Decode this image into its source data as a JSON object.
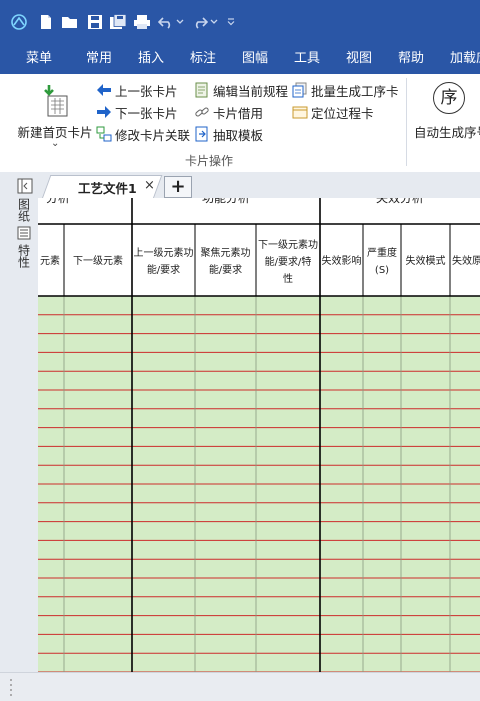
{
  "quick_access": {
    "icons": [
      "app-logo-icon",
      "new-file-icon",
      "open-folder-icon",
      "save-icon",
      "save-all-icon",
      "print-icon",
      "undo-icon",
      "undo-dropdown-icon",
      "redo-icon",
      "redo-dropdown-icon",
      "customize-qat-icon"
    ]
  },
  "menu": {
    "tabs": [
      {
        "label": "菜单"
      },
      {
        "label": "常用"
      },
      {
        "label": "插入"
      },
      {
        "label": "标注"
      },
      {
        "label": "图幅"
      },
      {
        "label": "工具"
      },
      {
        "label": "视图"
      },
      {
        "label": "帮助"
      },
      {
        "label": "加载应"
      }
    ]
  },
  "ribbon": {
    "new_home_card": "新建首页卡片",
    "prev_card": "上一张卡片",
    "next_card": "下一张卡片",
    "modify_card_link": "修改卡片关联",
    "edit_current_rule": "编辑当前规程",
    "borrow_card": "卡片借用",
    "extract_template": "抽取模板",
    "batch_generate": "批量生成工序卡",
    "locate_process_card": "定位过程卡",
    "auto_generate_seq": "自动生成序号",
    "seq_glyph": "序",
    "group_label": "卡片操作"
  },
  "side_tabs": {
    "tab1": "图纸",
    "tab2": "特性"
  },
  "document": {
    "tab_label": "工艺文件1",
    "close_glyph": "×",
    "add_glyph": "+"
  },
  "table": {
    "group_headers": [
      "分析",
      "功能分析",
      "失效分析"
    ],
    "columns": [
      "元素",
      "下一级元素",
      "上一级元素功能/要求",
      "聚焦元素功能/要求",
      "下一级元素功能/要求/特性",
      "失效影响",
      "严重度(S)",
      "失效模式",
      "失效原"
    ],
    "body_rows": 20,
    "body_color": "#d4ecc6",
    "line_color": "#cc2b2b"
  },
  "colors": {
    "title_bar": "#2a56a6",
    "ribbon_bg": "#ffffff"
  }
}
